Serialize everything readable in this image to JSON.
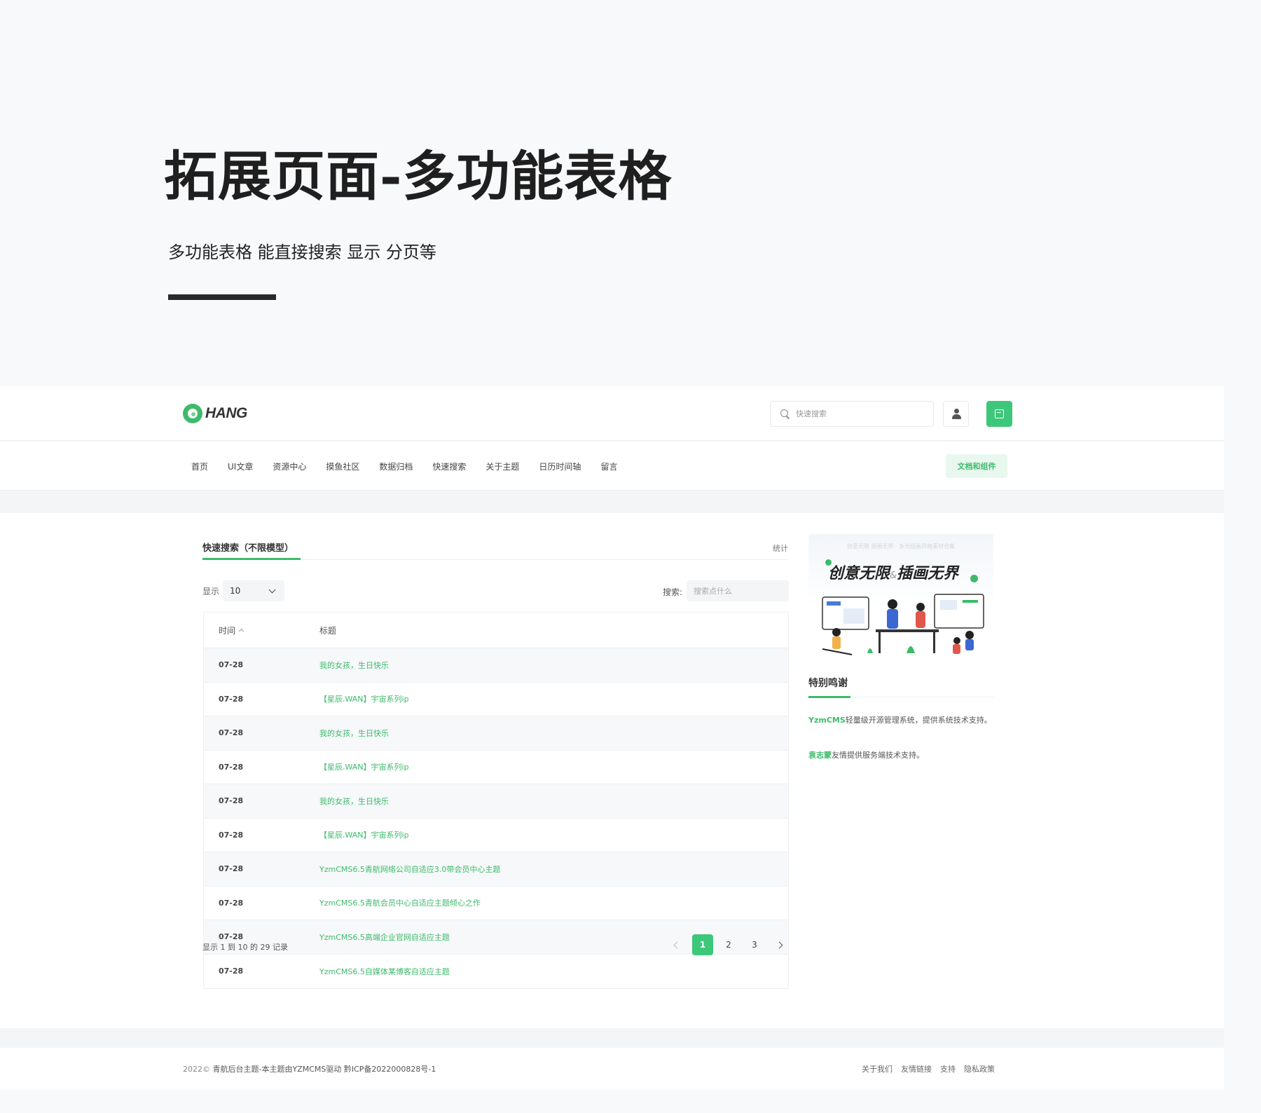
{
  "promo": {
    "title": "拓展页面-多功能表格",
    "subtitle": "多功能表格 能直接搜索 显示 分页等"
  },
  "header": {
    "logo_text": "HANG",
    "search_placeholder": "快速搜索"
  },
  "nav": {
    "items": [
      "首页",
      "UI文章",
      "资源中心",
      "摸鱼社区",
      "数据归档",
      "快速搜索",
      "关于主题",
      "日历时间轴",
      "留言"
    ],
    "doc_button": "文档和组件"
  },
  "card": {
    "tab": "快速搜索（不限模型）",
    "stat_link": "统计",
    "show_label": "显示",
    "page_size": "10",
    "search_label": "搜索:",
    "search_placeholder": "搜索点什么"
  },
  "table": {
    "columns": [
      "时间",
      "标题"
    ],
    "rows": [
      {
        "time": "07-28",
        "title": "我的女孩，生日快乐"
      },
      {
        "time": "07-28",
        "title": "【星辰.WAN】宇宙系列ip"
      },
      {
        "time": "07-28",
        "title": "我的女孩，生日快乐"
      },
      {
        "time": "07-28",
        "title": "【星辰.WAN】宇宙系列ip"
      },
      {
        "time": "07-28",
        "title": "我的女孩，生日快乐"
      },
      {
        "time": "07-28",
        "title": "【星辰.WAN】宇宙系列ip"
      },
      {
        "time": "07-28",
        "title": "YzmCMS6.5青航网络公司自适应3.0带会员中心主题"
      },
      {
        "time": "07-28",
        "title": "YzmCMS6.5青航会员中心自适应主题倾心之作"
      },
      {
        "time": "07-28",
        "title": "YzmCMS6.5高端企业官网自适应主题"
      },
      {
        "time": "07-28",
        "title": "YzmCMS6.5自媒体某博客自适应主题"
      }
    ],
    "records_info": "显示 1 到 10 的 29 记录"
  },
  "pagination": {
    "pages": [
      "1",
      "2",
      "3"
    ],
    "active": "1"
  },
  "sidebar": {
    "banner_caption": "创意无限 插画无界 · 多元插画风格素材合集",
    "banner_title_a": "创意无限",
    "banner_amp": "&",
    "banner_title_b": "插画无界",
    "thanks_title": "特别鸣谢",
    "thanks_1_brand": "YzmCMS",
    "thanks_1_text": "轻量级开源管理系统，提供系统技术支持。",
    "thanks_2_brand": "袁志蒙",
    "thanks_2_text": "友情提供服务端技术支持。"
  },
  "footer": {
    "year": "2022©",
    "copyright": "青航后台主题-本主题由YZMCMS驱动 黔ICP备2022000828号-1",
    "links": [
      "关于我们",
      "友情链接",
      "支持",
      "隐私政策"
    ]
  },
  "colors": {
    "accent": "#3dbb6b",
    "accent_bg": "#e9f8ef",
    "page_bg": "#f8f9fa"
  }
}
